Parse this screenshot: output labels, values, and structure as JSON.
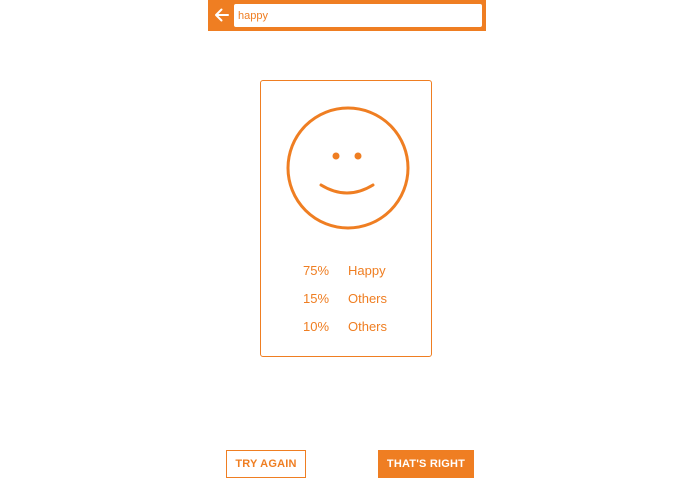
{
  "search": {
    "value": "happy",
    "placeholder": ""
  },
  "result": {
    "face_icon": "smiley-face-icon",
    "items": [
      {
        "percent": "75%",
        "label": "Happy"
      },
      {
        "percent": "15%",
        "label": "Others"
      },
      {
        "percent": "10%",
        "label": "Others"
      }
    ]
  },
  "actions": {
    "try_again_label": "TRY AGAIN",
    "confirm_label": "THAT'S RIGHT"
  },
  "colors": {
    "accent": "#EF7E22",
    "background": "#FFFFFF"
  }
}
